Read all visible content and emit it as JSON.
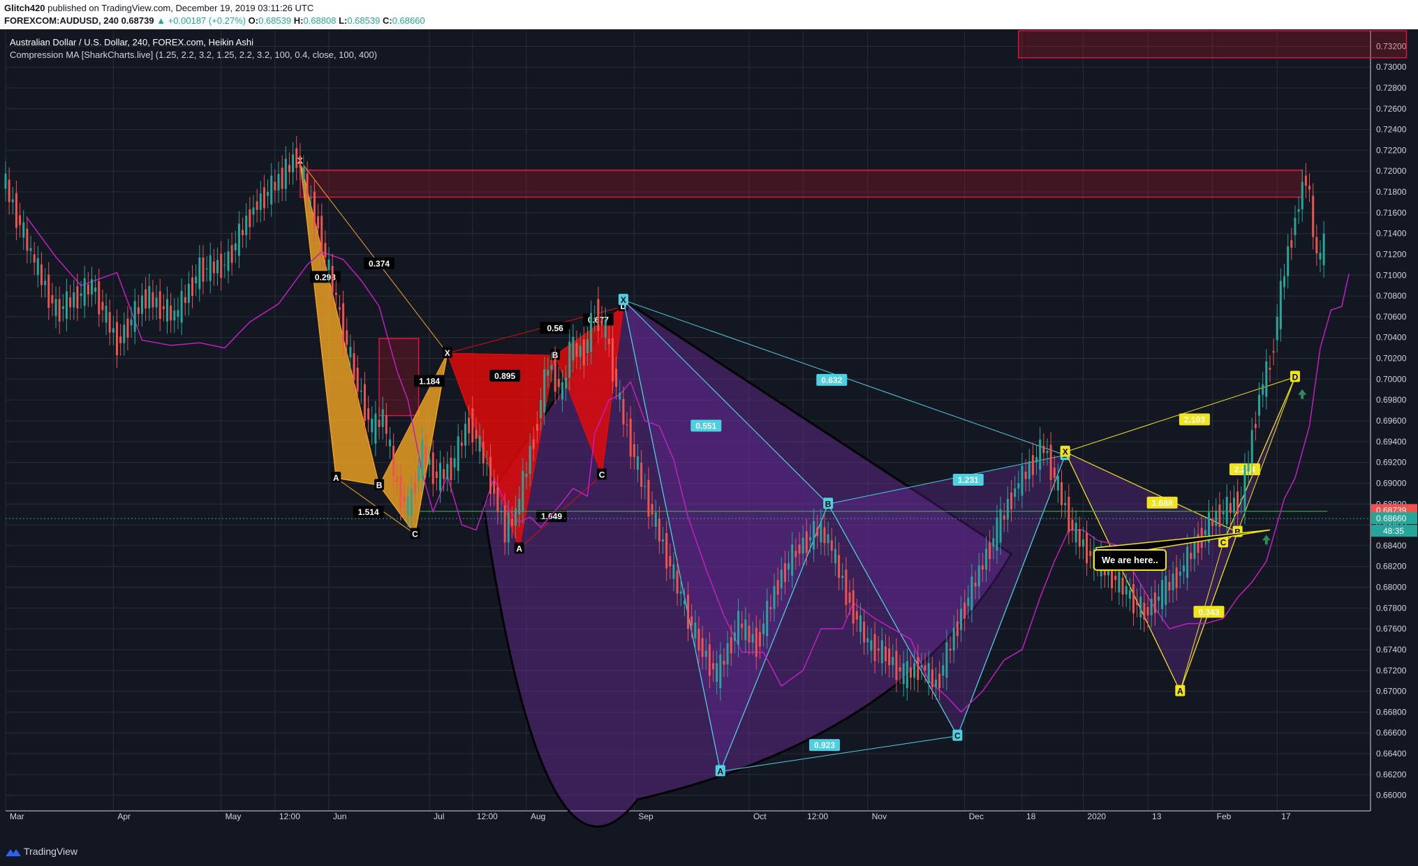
{
  "header": {
    "author": "Glitch420",
    "published": "published on TradingView.com, December 19, 2019 03:11:26 UTC",
    "symbol": "FOREXCOM:AUDUSD, 240",
    "price": "0.68739",
    "change": "▲ +0.00187 (+0.27%)",
    "ohlc": {
      "o_label": "O:",
      "o": "0.68539",
      "h_label": "H:",
      "h": "0.68808",
      "l_label": "L:",
      "l": "0.68539",
      "c_label": "C:",
      "c": "0.68660"
    }
  },
  "legend": {
    "title": "Australian Dollar / U.S. Dollar, 240, FOREX.com, Heikin Ashi",
    "indicator": "Compression MA [SharkCharts.live] (1.25, 2.2, 3.2, 1.25, 2.2, 3.2, 100, 0.4, close, 100, 400)"
  },
  "annotation": {
    "note": "We are here.."
  },
  "footer": {
    "brand": "TradingView"
  },
  "colors": {
    "up": "#26a69a",
    "down": "#ef5350",
    "orange": "#f5a623",
    "red": "#e00b0b",
    "purple": "#6a2c9a",
    "cyan": "#4dd0e1",
    "yellow": "#f2e41a",
    "magenta": "#c21ec2"
  },
  "chart_data": {
    "type": "candlestick",
    "style": "Heikin Ashi",
    "y_axis": {
      "side": "right",
      "ylim": [
        0.6585,
        0.7335
      ],
      "ticks": [
        "0.73200",
        "0.73000",
        "0.72800",
        "0.72600",
        "0.72400",
        "0.72200",
        "0.72000",
        "0.71800",
        "0.71600",
        "0.71400",
        "0.71200",
        "0.71000",
        "0.70800",
        "0.70600",
        "0.70400",
        "0.70200",
        "0.70000",
        "0.69800",
        "0.69600",
        "0.69400",
        "0.69200",
        "0.69000",
        "0.68800",
        "0.68600",
        "0.68400",
        "0.68200",
        "0.68000",
        "0.67800",
        "0.67600",
        "0.67400",
        "0.67200",
        "0.67000",
        "0.66800",
        "0.66600",
        "0.66400",
        "0.66200",
        "0.66000"
      ]
    },
    "x_axis": {
      "ticks": [
        "Mar",
        "Apr",
        "May",
        "12:00",
        "Jun",
        "Jul",
        "12:00",
        "Aug",
        "Sep",
        "Oct",
        "12:00",
        "Nov",
        "Dec",
        "18",
        "2020",
        "13",
        "Feb",
        "17"
      ]
    },
    "price_labels": {
      "last": "0.68739",
      "close": "0.68660",
      "countdown": "48:35"
    },
    "price_series": [
      [
        0,
        0.7195
      ],
      [
        8,
        0.712
      ],
      [
        15,
        0.7065
      ],
      [
        25,
        0.709
      ],
      [
        32,
        0.7035
      ],
      [
        40,
        0.708
      ],
      [
        48,
        0.706
      ],
      [
        55,
        0.7105
      ],
      [
        62,
        0.711
      ],
      [
        70,
        0.7165
      ],
      [
        78,
        0.7195
      ],
      [
        82,
        0.7215
      ],
      [
        88,
        0.7145
      ],
      [
        93,
        0.7075
      ],
      [
        98,
        0.7005
      ],
      [
        103,
        0.695
      ],
      [
        106,
        0.6965
      ],
      [
        110,
        0.6895
      ],
      [
        113,
        0.6875
      ],
      [
        117,
        0.693
      ],
      [
        121,
        0.6905
      ],
      [
        125,
        0.6915
      ],
      [
        130,
        0.696
      ],
      [
        134,
        0.6925
      ],
      [
        137,
        0.689
      ],
      [
        140,
        0.6855
      ],
      [
        143,
        0.687
      ],
      [
        148,
        0.6945
      ],
      [
        152,
        0.7015
      ],
      [
        156,
        0.6985
      ],
      [
        158,
        0.703
      ],
      [
        162,
        0.7025
      ],
      [
        165,
        0.7065
      ],
      [
        168,
        0.7045
      ],
      [
        172,
        0.6975
      ],
      [
        176,
        0.6925
      ],
      [
        180,
        0.688
      ],
      [
        184,
        0.684
      ],
      [
        189,
        0.679
      ],
      [
        194,
        0.6745
      ],
      [
        199,
        0.6715
      ],
      [
        205,
        0.6765
      ],
      [
        210,
        0.6745
      ],
      [
        216,
        0.6805
      ],
      [
        221,
        0.6835
      ],
      [
        227,
        0.6855
      ],
      [
        230,
        0.6845
      ],
      [
        236,
        0.6785
      ],
      [
        241,
        0.6745
      ],
      [
        246,
        0.6735
      ],
      [
        251,
        0.6715
      ],
      [
        256,
        0.6725
      ],
      [
        260,
        0.6705
      ],
      [
        266,
        0.6765
      ],
      [
        272,
        0.6815
      ],
      [
        277,
        0.6855
      ],
      [
        282,
        0.6895
      ],
      [
        286,
        0.6915
      ],
      [
        290,
        0.6935
      ],
      [
        294,
        0.6895
      ],
      [
        298,
        0.6855
      ],
      [
        304,
        0.6825
      ],
      [
        308,
        0.6815
      ],
      [
        313,
        0.6795
      ],
      [
        318,
        0.6775
      ],
      [
        323,
        0.6795
      ],
      [
        328,
        0.6815
      ],
      [
        333,
        0.6845
      ],
      [
        337,
        0.6865
      ],
      [
        341,
        0.6875
      ],
      [
        345,
        0.6885
      ],
      [
        350,
        0.6985
      ],
      [
        353,
        0.7015
      ],
      [
        357,
        0.7105
      ],
      [
        360,
        0.7155
      ],
      [
        363,
        0.7198
      ],
      [
        366,
        0.7115
      ],
      [
        368,
        0.7128
      ]
    ],
    "resistance_zones": [
      {
        "x0": 82,
        "x1": 361,
        "y0": 0.7175,
        "y1": 0.7201
      },
      {
        "x0": 282,
        "x1": 390,
        "y0": 0.7309,
        "y1": 0.7335
      },
      {
        "x0": 104,
        "x1": 115,
        "y0": 0.6965,
        "y1": 0.7039
      }
    ],
    "patterns": [
      {
        "name": "orange",
        "color": "#f5a623",
        "points": [
          [
            "X",
            82,
            0.721
          ],
          [
            "A",
            92,
            0.6905
          ],
          [
            "B",
            104,
            0.6898
          ],
          [
            "C",
            114,
            0.6851
          ],
          [
            "D",
            123,
            0.7025
          ]
        ],
        "ratios": [
          [
            "0.293",
            89,
            0.7098
          ],
          [
            "0.374",
            104,
            0.7111
          ],
          [
            "1.184",
            118,
            0.6998
          ],
          [
            "1.514",
            101,
            0.6872
          ]
        ]
      },
      {
        "name": "red",
        "color": "#e00b0b",
        "points": [
          [
            "X",
            123,
            0.7025
          ],
          [
            "A",
            143,
            0.6837
          ],
          [
            "B",
            153,
            0.7023
          ],
          [
            "C",
            166,
            0.6908
          ],
          [
            "D",
            172,
            0.707
          ]
        ],
        "ratios": [
          [
            "0.895",
            139,
            0.7003
          ],
          [
            "0.56",
            153,
            0.7049
          ],
          [
            "0.677",
            165,
            0.7057
          ],
          [
            "1.649",
            152,
            0.6868
          ]
        ]
      },
      {
        "name": "purple-cyan",
        "color": "#4dd0e1",
        "points": [
          [
            "X",
            172,
            0.7076
          ],
          [
            "A",
            199,
            0.6623
          ],
          [
            "B",
            229,
            0.688
          ],
          [
            "C",
            265,
            0.6657
          ],
          [
            "D",
            295,
            0.6927
          ]
        ],
        "ratios": [
          [
            "0.551",
            195,
            0.6955
          ],
          [
            "0.632",
            230,
            0.6999
          ],
          [
            "1.231",
            268,
            0.6903
          ],
          [
            "0.923",
            228,
            0.6648
          ]
        ]
      },
      {
        "name": "yellow",
        "color": "#f2e41a",
        "points": [
          [
            "X",
            295,
            0.693
          ],
          [
            "A",
            327,
            0.67
          ],
          [
            "B",
            343,
            0.6853
          ],
          [
            "C",
            339,
            0.6843
          ],
          [
            "D",
            359,
            0.7002
          ]
        ],
        "ratios": [
          [
            "2.103",
            331,
            0.6961
          ],
          [
            "1.688",
            322,
            0.6881
          ],
          [
            "0.343",
            335,
            0.6776
          ],
          [
            "2.214",
            345,
            0.6913
          ]
        ]
      }
    ],
    "markers": [
      {
        "type": "arrow-up",
        "x": 361,
        "y": 0.6985
      },
      {
        "type": "arrow-up",
        "x": 351,
        "y": 0.6845
      }
    ],
    "horizontal_lines": [
      {
        "y": 0.6873,
        "x0": 115,
        "x1": 368,
        "color": "#2db34a"
      }
    ],
    "legend": "none",
    "grid": true
  }
}
